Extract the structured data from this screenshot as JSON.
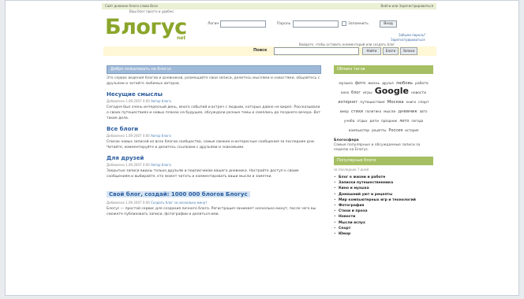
{
  "topbar": {
    "left": "Сайт дневник блоги слова Всех",
    "right": "Войти или Зарегистрироваться"
  },
  "logo": {
    "text": "Блогус",
    "suffix": "net",
    "tagline": "Ваш блог просто и удобно"
  },
  "login": {
    "login_label": "Логин",
    "password_label": "Пароль",
    "remember_label": "Запомнить",
    "submit_label": "Вход",
    "forgot": "Забыли пароль?",
    "register": "Зарегистрироваться",
    "note": "Войдите, чтобы оставить комментарий или создать блог"
  },
  "search": {
    "label": "Поиск",
    "value": "",
    "buttons": [
      "Найти",
      "Блоги",
      "Записи"
    ]
  },
  "main": {
    "headline": "Добро пожаловать на Блогус",
    "intro": "Это сервис ведения блогов и дневников, размещайте свои записи, делитесь мыслями и новостями, общайтесь с друзьями и читайте любимых авторов.",
    "posts": [
      {
        "title": "Несущие смыслы",
        "highlight": false,
        "meta_date": "Добавлено 1.09.2007 0:00",
        "meta_author": "Автор блога",
        "body": "Сегодня был очень интересный день, много событий и встреч с людьми, которых давно не видел. Рассказывали о своих путешествиях и новых планах на будущее, обсуждали разные темы и смеялись до позднего вечера. Вот такие дела."
      },
      {
        "title": "Все блоги",
        "highlight": false,
        "meta_date": "Добавлено 1.09.2007 0:00",
        "meta_author": "Автор блога",
        "body": "Список новых записей из всех блогов сообщества, самые свежие и интересные сообщения за последние дни. Читайте, комментируйте и делитесь ссылками с друзьями и знакомыми."
      },
      {
        "title": "Для друзей",
        "highlight": false,
        "meta_date": "Добавлено 1.09.2007 0:00",
        "meta_author": "Автор блога",
        "body": "Закрытые записи видны только друзьям и подписчикам вашего дневника. Настройте доступ к своим сообщениям и выбирайте, кто может читать и комментировать ваши мысли и заметки."
      },
      {
        "title": "Свой блог, создай: 1000 000 блогов Блогус",
        "highlight": true,
        "meta_date": "Добавлено 1.09.2007 0:00",
        "meta_author": "Создать блог за несколько минут",
        "body": "Блогус — простой сервис для создания личного блога. Регистрация занимает несколько минут, после чего вы сможете публиковать записи, фотографии и делиться ими."
      }
    ]
  },
  "side": {
    "cloud_title": "Облако тегов",
    "cloud": [
      {
        "t": "музыка",
        "s": 4.5
      },
      {
        "t": "фото",
        "s": 5
      },
      {
        "t": "жизнь",
        "s": 4.5
      },
      {
        "t": "друзья",
        "s": 4
      },
      {
        "t": "любовь",
        "s": 5.5
      },
      {
        "t": "работа",
        "s": 4.5
      },
      {
        "t": "кино",
        "s": 4
      },
      {
        "t": "блог",
        "s": 5
      },
      {
        "t": "игры",
        "s": 4.5
      },
      {
        "t": "Google",
        "s": 11
      },
      {
        "t": "новости",
        "s": 4.5
      },
      {
        "t": "интернет",
        "s": 5
      },
      {
        "t": "путешествия",
        "s": 4.5
      },
      {
        "t": "Москва",
        "s": 5.5
      },
      {
        "t": "книги",
        "s": 4
      },
      {
        "t": "спорт",
        "s": 4.5
      },
      {
        "t": "юмор",
        "s": 4
      },
      {
        "t": "стихи",
        "s": 5
      },
      {
        "t": "политика",
        "s": 4
      },
      {
        "t": "мысли",
        "s": 4.5
      },
      {
        "t": "дневник",
        "s": 5.5
      },
      {
        "t": "авто",
        "s": 4
      },
      {
        "t": "учеба",
        "s": 4.5
      },
      {
        "t": "отдых",
        "s": 4
      },
      {
        "t": "дети",
        "s": 4.5
      },
      {
        "t": "праздник",
        "s": 4
      },
      {
        "t": "лето",
        "s": 5
      },
      {
        "t": "погода",
        "s": 4
      },
      {
        "t": "компьютер",
        "s": 4.5
      },
      {
        "t": "рецепты",
        "s": 4
      },
      {
        "t": "Россия",
        "s": 5
      },
      {
        "t": "история",
        "s": 4
      }
    ],
    "note_title": "Блогосфера",
    "note_text": "Самые популярные и обсуждаемые записи за неделю на Блогус.",
    "list_title": "Популярные блоги",
    "list_sub": "за последние 7 дней",
    "blogs": [
      "Блог о жизни и работе",
      "Записки путешественника",
      "Кино и музыка",
      "Домашний уют и рецепты",
      "Мир компьютерных игр и технологий",
      "Фотография",
      "Стихи и проза",
      "Новости",
      "Мысли вслух",
      "Спорт",
      "Юмор"
    ]
  }
}
